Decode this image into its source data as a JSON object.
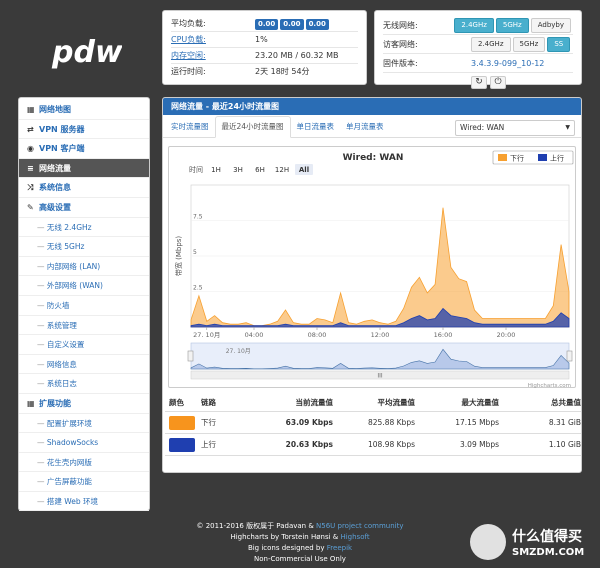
{
  "logo_text": "pdw",
  "status": {
    "load_label": "平均负载:",
    "load_values": [
      "0.00",
      "0.00",
      "0.00"
    ],
    "cpu_label": "CPU负载:",
    "cpu_value": "1%",
    "mem_label": "内存空闲:",
    "mem_value": "23.20 MB / 60.32 MB",
    "uptime_label": "运行时间:",
    "uptime_value": "2天 18时 54分"
  },
  "wifi": {
    "wireless_label": "无线网络:",
    "wireless_buttons": [
      "2.4GHz",
      "5GHz",
      "Adbyby"
    ],
    "guest_label": "访客网络:",
    "guest_buttons": [
      "2.4GHz",
      "5GHz",
      "SS"
    ],
    "fw_label": "固件版本:",
    "fw_value": "3.4.3.9-099_10-12",
    "refresh_icon": "refresh-icon",
    "power_icon": "power-icon"
  },
  "nav": {
    "items": [
      {
        "label": "网络地图",
        "icon": "sitemap-icon",
        "type": "item"
      },
      {
        "label": "VPN 服务器",
        "icon": "vpn-server-icon",
        "type": "item"
      },
      {
        "label": "VPN 客户端",
        "icon": "vpn-client-icon",
        "type": "item"
      },
      {
        "label": "网络流量",
        "icon": "traffic-icon",
        "type": "item",
        "active": true
      },
      {
        "label": "系统信息",
        "icon": "shuffle-icon",
        "type": "item"
      },
      {
        "label": "高级设置",
        "icon": "wrench-icon",
        "type": "item"
      },
      {
        "label": "无线 2.4GHz",
        "type": "sub"
      },
      {
        "label": "无线 5GHz",
        "type": "sub"
      },
      {
        "label": "内部网络 (LAN)",
        "type": "sub"
      },
      {
        "label": "外部网络 (WAN)",
        "type": "sub"
      },
      {
        "label": "防火墙",
        "type": "sub"
      },
      {
        "label": "系统管理",
        "type": "sub"
      },
      {
        "label": "自定义设置",
        "type": "sub"
      },
      {
        "label": "网络信息",
        "type": "sub"
      },
      {
        "label": "系统日志",
        "type": "sub"
      },
      {
        "label": "扩展功能",
        "icon": "grid-icon",
        "type": "item"
      },
      {
        "label": "配置扩展环境",
        "type": "sub"
      },
      {
        "label": "ShadowSocks",
        "type": "sub"
      },
      {
        "label": "花生壳内网版",
        "type": "sub"
      },
      {
        "label": "广告屏蔽功能",
        "type": "sub"
      },
      {
        "label": "搭建 Web 环境",
        "type": "sub"
      }
    ]
  },
  "main": {
    "header": "网络流量 - 最近24小时流量图",
    "tabs": [
      "实时流量图",
      "最近24小时流量图",
      "单日流量表",
      "单月流量表"
    ],
    "active_tab": 1,
    "select_value": "Wired: WAN"
  },
  "chart_data": {
    "type": "area",
    "title": "Wired: WAN",
    "ylabel": "带宽 (Mbps)",
    "ylim": [
      0,
      10
    ],
    "yticks": [
      "2.5",
      "5",
      "7.5"
    ],
    "range_label": "时间",
    "range_buttons": [
      "1H",
      "3H",
      "6H",
      "12H",
      "All"
    ],
    "active_range": "All",
    "xticks": [
      "27. 10月",
      "04:00",
      "08:00",
      "12:00",
      "16:00",
      "20:00"
    ],
    "navigator_label": "27. 10月",
    "credit": "Highcharts.com",
    "legend": [
      {
        "name": "下行",
        "color": "#f7a030"
      },
      {
        "name": "上行",
        "color": "#1f3fb0"
      }
    ],
    "x_hours": [
      0,
      0.5,
      1,
      1.5,
      2,
      2.5,
      3,
      3.5,
      4,
      4.5,
      5,
      5.5,
      6,
      6.5,
      7,
      7.5,
      8,
      8.5,
      9,
      9.5,
      10,
      10.5,
      11,
      11.5,
      12,
      12.5,
      13,
      13.5,
      14,
      14.5,
      15,
      15.5,
      16,
      16.5,
      17,
      17.5,
      18,
      18.5,
      19,
      19.5,
      20,
      20.5,
      21,
      21.5,
      22,
      22.5,
      23,
      23.5,
      24
    ],
    "series": [
      {
        "name": "下行",
        "color": "#f7a030",
        "values": [
          0.5,
          2.2,
          0.4,
          0.8,
          0.3,
          0.2,
          0.2,
          0.3,
          0.1,
          0.1,
          0.2,
          0.4,
          1.2,
          0.3,
          0.2,
          0.2,
          0.6,
          0.5,
          0.3,
          2.4,
          0.3,
          0.2,
          0.4,
          0.5,
          0.3,
          0.2,
          0.4,
          1.3,
          2.8,
          3.5,
          2.4,
          3.0,
          8.4,
          4.2,
          3.4,
          3.2,
          1.2,
          0.6,
          0.6,
          0.6,
          0.6,
          0.6,
          0.6,
          0.6,
          0.6,
          0.6,
          1.5,
          5.8,
          2.5
        ]
      },
      {
        "name": "上行",
        "color": "#1f3fb0",
        "values": [
          0.1,
          0.2,
          0.1,
          0.2,
          0.1,
          0.1,
          0.1,
          0.1,
          0.1,
          0.1,
          0.1,
          0.1,
          0.2,
          0.1,
          0.1,
          0.1,
          0.1,
          0.1,
          0.1,
          0.3,
          0.1,
          0.1,
          0.1,
          0.1,
          0.1,
          0.1,
          0.1,
          0.3,
          0.6,
          0.8,
          0.5,
          0.6,
          1.3,
          0.8,
          0.7,
          0.6,
          0.3,
          0.2,
          0.2,
          0.2,
          0.2,
          0.2,
          0.2,
          0.2,
          0.2,
          0.2,
          0.4,
          1.0,
          0.6
        ]
      }
    ]
  },
  "stats": {
    "headers": [
      "颜色",
      "链路",
      "当前流量值",
      "平均流量值",
      "最大流量值",
      "总共量值"
    ],
    "rows": [
      {
        "color": "#f7941d",
        "link": "下行",
        "current": "63.09 Kbps",
        "avg": "825.88 Kbps",
        "max": "17.15 Mbps",
        "total": "8.31 GiB"
      },
      {
        "color": "#1f3fb0",
        "link": "上行",
        "current": "20.63 Kbps",
        "avg": "108.98 Kbps",
        "max": "3.09 Mbps",
        "total": "1.10 GiB"
      }
    ]
  },
  "footer": {
    "line1_a": "© 2011-2016 版权属于 Padavan &",
    "line1_b": "N56U project community",
    "line2_a": "Highcharts by Torstein Hønsi &",
    "line2_b": "Highsoft",
    "line3_a": "Big icons designed by",
    "line3_b": "Freepik",
    "line4": "Non-Commercial Use Only"
  },
  "watermark": {
    "text1": "什么值得买",
    "text2": "SMZDM.COM"
  }
}
